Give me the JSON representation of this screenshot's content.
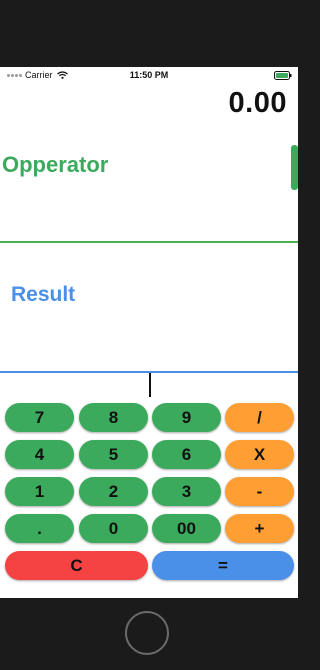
{
  "status_bar": {
    "carrier": "Carrier",
    "time": "11:50 PM"
  },
  "display": {
    "value": "0.00"
  },
  "operator": {
    "label": "Opperator"
  },
  "result": {
    "label": "Result"
  },
  "keypad": {
    "rows": [
      [
        {
          "label": "7",
          "kind": "num"
        },
        {
          "label": "8",
          "kind": "num"
        },
        {
          "label": "9",
          "kind": "num"
        },
        {
          "label": "/",
          "kind": "op"
        }
      ],
      [
        {
          "label": "4",
          "kind": "num"
        },
        {
          "label": "5",
          "kind": "num"
        },
        {
          "label": "6",
          "kind": "num"
        },
        {
          "label": "X",
          "kind": "op"
        }
      ],
      [
        {
          "label": "1",
          "kind": "num"
        },
        {
          "label": "2",
          "kind": "num"
        },
        {
          "label": "3",
          "kind": "num"
        },
        {
          "label": "-",
          "kind": "op"
        }
      ],
      [
        {
          "label": ".",
          "kind": "num"
        },
        {
          "label": "0",
          "kind": "num"
        },
        {
          "label": "00",
          "kind": "num"
        },
        {
          "label": "+",
          "kind": "op"
        }
      ]
    ],
    "clear_label": "C",
    "equals_label": "="
  },
  "colors": {
    "digit_key": "#3caa5c",
    "operator_key": "#ff9e33",
    "clear_key": "#f54242",
    "equals_key": "#4a8fe8",
    "operator_text": "#3caa5c",
    "result_text": "#4a8fe8"
  },
  "icons": [
    "signal-dots-icon",
    "wifi-icon",
    "battery-icon",
    "home-button"
  ]
}
